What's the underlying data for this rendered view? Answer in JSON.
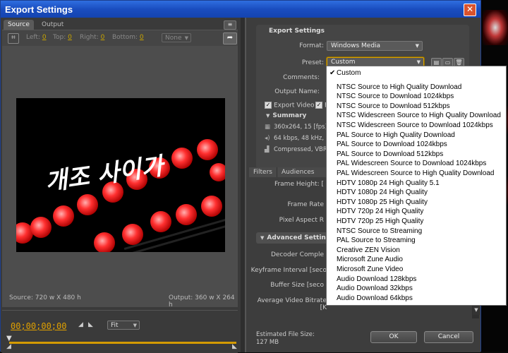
{
  "window": {
    "title": "Export Settings",
    "close_glyph": "✕"
  },
  "source_panel": {
    "tabs": [
      "Source",
      "Output"
    ],
    "crop": {
      "left_label": "Left:",
      "left_value": "0",
      "top_label": "Top:",
      "top_value": "0",
      "right_label": "Right:",
      "right_value": "0",
      "bottom_label": "Bottom:",
      "bottom_value": "0",
      "ratio": "None"
    },
    "video_overlay_text": "개조 사이가",
    "source_info": "Source: 720 w X 480 h",
    "output_info": "Output: 360 w X 264 h",
    "timecode": "00;00;00;00",
    "zoom": "Fit"
  },
  "export_settings": {
    "header": "Export Settings",
    "format_label": "Format:",
    "format_value": "Windows Media",
    "preset_label": "Preset:",
    "preset_value": "Custom",
    "comments_label": "Comments:",
    "output_name_label": "Output Name:",
    "export_video_label": "Export Video",
    "export_audio_label": "E",
    "summary_label": "Summary",
    "summary_lines": [
      "360x264, 15 [fps]",
      "64 kbps, 48 kHz, st",
      "Compressed, VBR, 2"
    ]
  },
  "lower_tabs": [
    "Filters",
    "Audiences"
  ],
  "video_settings": {
    "frame_height_label": "Frame Height: [",
    "frame_rate_label": "Frame Rate",
    "pixel_aspect_label": "Pixel Aspect R",
    "advanced_label": "Advanced Settings",
    "decoder_label": "Decoder Comple",
    "keyframe_label": "Keyframe Interval [seco",
    "buffer_label": "Buffer Size [seco",
    "avg_bitrate_label": "Average Video Bitrate [K"
  },
  "footer": {
    "estimated_label": "Estimated File Size:",
    "estimated_value": "127 MB",
    "ok": "OK",
    "cancel": "Cancel"
  },
  "preset_menu": {
    "selected": "Custom",
    "items": [
      "Custom",
      "NTSC Source to High Quality Download",
      "NTSC Source to Download 1024kbps",
      "NTSC Source to Download 512kbps",
      "NTSC Widescreen Source to High Quality Download",
      "NTSC Widescreen Source to Download 1024kbps",
      "PAL Source to High Quality Download",
      "PAL Source to Download 1024kbps",
      "PAL Source to Download 512kbps",
      "PAL Widescreen Source to Download 1024kbps",
      "PAL Widescreen Source to High Quality Download",
      "HDTV 1080p 24 High Quality 5.1",
      "HDTV 1080p 24 High Quality",
      "HDTV 1080p 25 High Quality",
      "HDTV 720p 24 High Quality",
      "HDTV 720p 25 High Quality",
      "NTSC Source to Streaming",
      "PAL Source to Streaming",
      "Creative ZEN Vision",
      "Microsoft Zune Audio",
      "Microsoft Zune Video",
      "Audio Download 128kbps",
      "Audio Download 32kbps",
      "Audio Download 64kbps"
    ]
  }
}
